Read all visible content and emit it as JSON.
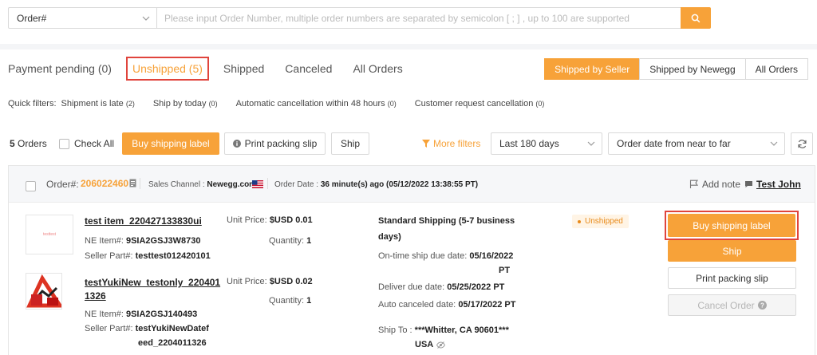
{
  "search": {
    "type_value": "Order#",
    "placeholder": "Please input Order Number,  multiple order numbers are separated by semicolon [ ; ] , up to 100 are supported"
  },
  "tabs": [
    {
      "label": "Payment pending (0)"
    },
    {
      "label": "Unshipped (5)"
    },
    {
      "label": "Shipped"
    },
    {
      "label": "Canceled"
    },
    {
      "label": "All Orders"
    }
  ],
  "ship_filter": [
    "Shipped by Seller",
    "Shipped by Newegg",
    "All Orders"
  ],
  "quick_filters": {
    "label": "Quick filters:",
    "items": [
      {
        "label": "Shipment is late",
        "count": "(2)"
      },
      {
        "label": "Ship by today",
        "count": "(0)"
      },
      {
        "label": "Automatic cancellation within 48 hours",
        "count": "(0)"
      },
      {
        "label": "Customer request cancellation",
        "count": "(0)"
      }
    ]
  },
  "toolbar": {
    "orders_count": "5",
    "orders_label": "Orders",
    "check_all": "Check All",
    "buy_label": "Buy shipping label",
    "print_slip": "Print packing slip",
    "ship": "Ship",
    "more_filters": "More filters",
    "date_range": "Last 180 days",
    "sort": "Order date from near to far"
  },
  "order": {
    "number_label": "Order#:",
    "number": "206022460",
    "channel_label": "Sales Channel :",
    "channel": "Newegg.com",
    "date_label": "Order Date :",
    "date": "36 minute(s) ago (05/12/2022 13:38:55 PT)",
    "add_note": "Add note",
    "customer": "Test John",
    "items": [
      {
        "thumb_text": "testtest",
        "title": "test item_220427133830ui",
        "ne_label": "NE Item#:",
        "ne_value": "9SIA2GSJ3W8730",
        "seller_label": "Seller Part#:",
        "seller_value": "testtest012420101",
        "price_label": "Unit Price:",
        "price_value": "$USD 0.01",
        "qty_label": "Quantity:",
        "qty_value": "1"
      },
      {
        "title_line1": "testYukiNew_testonly_220401",
        "title_line2": "1326",
        "ne_label": "NE Item#:",
        "ne_value": "9SIA2GSJ140493",
        "seller_label": "Seller Part#:",
        "seller_line1": "testYukiNewDatef",
        "seller_line2": "eed_2204011326",
        "price_label": "Unit Price:",
        "price_value": "$USD 0.02",
        "qty_label": "Quantity:",
        "qty_value": "1"
      }
    ],
    "shipping_line1": "Standard Shipping (5-7 business",
    "shipping_line2": "days)",
    "ontime_label": "On-time ship due date:",
    "ontime_date": "05/16/2022",
    "ontime_tz": "PT",
    "deliver_label": "Deliver due date:",
    "deliver_value": "05/25/2022 PT",
    "autocancel_label": "Auto canceled date:",
    "autocancel_value": "05/17/2022 PT",
    "shipto_label": "Ship To :",
    "shipto_line1": "***Whitter, CA 90601***",
    "shipto_line2": "USA",
    "status": "Unshipped",
    "actions": {
      "buy": "Buy shipping label",
      "ship": "Ship",
      "print": "Print packing slip",
      "cancel": "Cancel Order"
    }
  },
  "colors": {
    "accent": "#f7a239",
    "highlight_border": "#e0443c",
    "status_bg": "#fff4e5"
  }
}
